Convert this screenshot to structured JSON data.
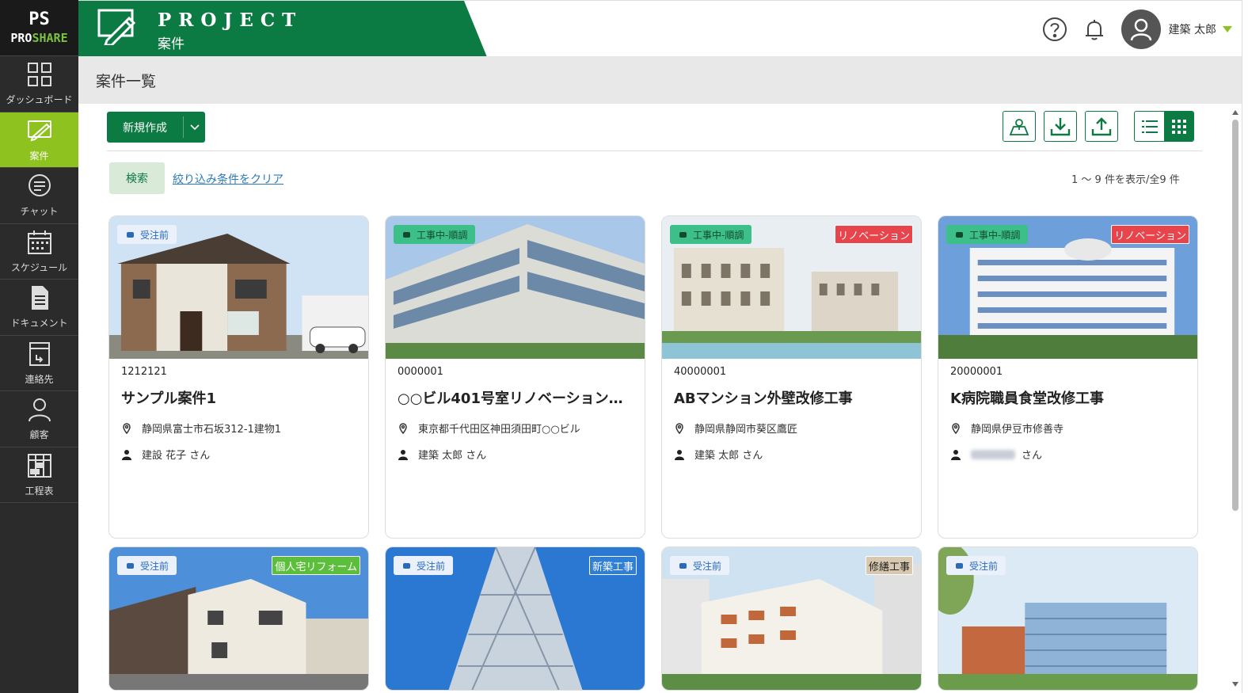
{
  "sidebar": {
    "logo": {
      "mark": "PS",
      "text_a": "PRO",
      "text_b": "SHARE"
    },
    "items": [
      {
        "label": "ダッシュボード",
        "icon": "dashboard-icon"
      },
      {
        "label": "案件",
        "icon": "ruler-pencil-icon"
      },
      {
        "label": "チャット",
        "icon": "chat-icon"
      },
      {
        "label": "スケジュール",
        "icon": "calendar-icon"
      },
      {
        "label": "ドキュメント",
        "icon": "document-icon"
      },
      {
        "label": "連絡先",
        "icon": "contact-icon"
      },
      {
        "label": "顧客",
        "icon": "user-icon"
      },
      {
        "label": "工程表",
        "icon": "gantt-icon"
      }
    ]
  },
  "header": {
    "title": "PROJECT",
    "subtitle": "案件",
    "user_name": "建築 太郎"
  },
  "page": {
    "title": "案件一覧"
  },
  "toolbar": {
    "new_label": "新規作成",
    "search_label": "検索",
    "clear_label": "絞り込み条件をクリア",
    "count_text": "1 ～ 9 件を表示/全9 件"
  },
  "colors": {
    "brand_green": "#0c7a43",
    "accent_lime": "#8dc21f",
    "status_before": "#2a6ab8",
    "status_working": "#3dbf8a",
    "badge_renovation": "#e8444b"
  },
  "cards": [
    {
      "status": "受注前",
      "status_kind": "before",
      "type": "",
      "type_color": "",
      "code": "1212121",
      "title": "サンプル案件1",
      "address": "静岡県富士市石坂312-1建物1",
      "person": "建設 花子 さん"
    },
    {
      "status": "工事中-順調",
      "status_kind": "working",
      "type": "",
      "type_color": "",
      "code": "0000001",
      "title": "○○ビル401号室リノベーション…",
      "address": "東京都千代田区神田須田町○○ビル",
      "person": "建築 太郎 さん"
    },
    {
      "status": "工事中-順調",
      "status_kind": "working",
      "type": "リノベーション",
      "type_color": "#e8444b",
      "code": "40000001",
      "title": "ABマンション外壁改修工事",
      "address": "静岡県静岡市葵区鷹匠",
      "person": "建築 太郎 さん"
    },
    {
      "status": "工事中-順調",
      "status_kind": "working",
      "type": "リノベーション",
      "type_color": "#e8444b",
      "code": "20000001",
      "title": "K病院職員食堂改修工事",
      "address": "静岡県伊豆市修善寺",
      "person": "さん"
    },
    {
      "status": "受注前",
      "status_kind": "before",
      "type": "個人宅リフォーム",
      "type_color": "#5cbf3c",
      "code": "",
      "title": "",
      "address": "",
      "person": ""
    },
    {
      "status": "受注前",
      "status_kind": "before",
      "type": "新築工事",
      "type_color": "#2f7fd6",
      "code": "",
      "title": "",
      "address": "",
      "person": ""
    },
    {
      "status": "受注前",
      "status_kind": "before",
      "type": "修繕工事",
      "type_color": "#d8c8b0",
      "code": "",
      "title": "",
      "address": "",
      "person": ""
    },
    {
      "status": "受注前",
      "status_kind": "before",
      "type": "",
      "type_color": "",
      "code": "",
      "title": "",
      "address": "",
      "person": ""
    }
  ]
}
